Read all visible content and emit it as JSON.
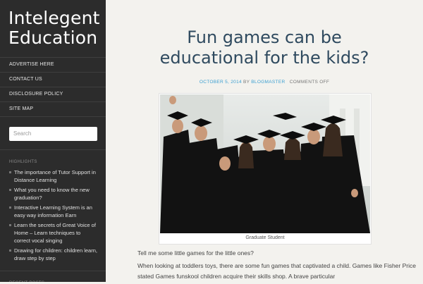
{
  "site": {
    "title_line1": "Intelegent",
    "title_line2": "Education"
  },
  "nav": {
    "items": [
      {
        "label": "ADVERTISE HERE"
      },
      {
        "label": "CONTACT US"
      },
      {
        "label": "DISCLOSURE POLICY"
      },
      {
        "label": "SITE MAP"
      }
    ]
  },
  "search": {
    "placeholder": "Search"
  },
  "highlights": {
    "title": "HIGHLIGHTS",
    "items": [
      "The importance of Tutor Support in Distance Learning",
      "What you need to know the new graduation?",
      "Interactive Learning System is an easy way information Earn",
      "Learn the secrets of Great Voice of Home – Learn techniques to correct vocal singing",
      "Drawing for children: children learn, draw step by step"
    ]
  },
  "recent_posts": {
    "title": "RECENT POSTS"
  },
  "post": {
    "title_line1": "Fun games can be",
    "title_line2": "educational for the kids?",
    "date": "OCTOBER 5, 2014",
    "by": "BY",
    "author": "BLOGMASTER",
    "comments": "COMMENTS OFF",
    "image_alt": "Graduates in caps and gowns",
    "caption": "Graduate Student",
    "paragraph1": "Tell me some little games for the little ones?",
    "paragraph2": "When looking at toddlers toys, there are some fun games that captivated a child. Games like Fisher Price stated Games funskool children acquire their skills shop. A brave particular"
  },
  "colors": {
    "sidebar_bg": "#2c2c2c",
    "title_blue": "#2f4a5f",
    "link_blue": "#3b9fd1",
    "page_bg": "#f3f2ee"
  }
}
